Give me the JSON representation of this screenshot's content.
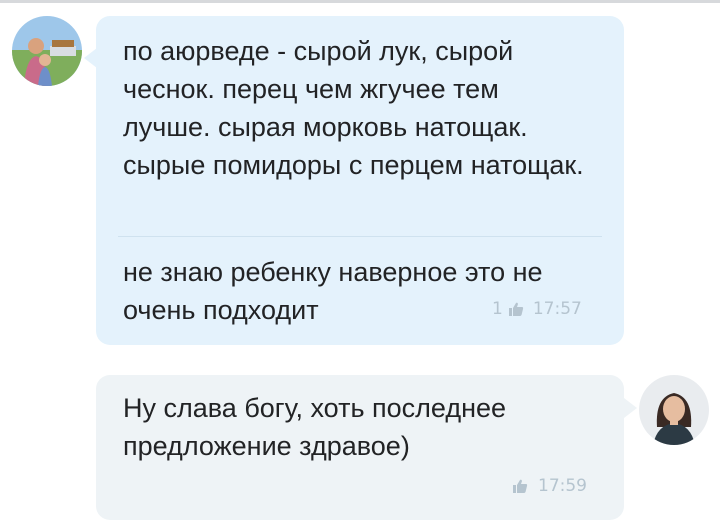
{
  "conversation": {
    "messages": [
      {
        "sender": "other",
        "avatar_icon": "user-avatar-icon",
        "parts": [
          {
            "text": "по аюрведе - сырой лук, сырой чеснок. перец чем жгучее тем лучше. сырая морковь натощак. сырые помидоры с перцем натощак."
          },
          {
            "text": "не знаю ребенку наверное это не очень подходит",
            "likes": "1",
            "time": "17:57"
          }
        ]
      },
      {
        "sender": "self",
        "avatar_icon": "user-avatar-icon",
        "parts": [
          {
            "text": "Ну слава богу, хоть последнее предложение здравое)",
            "time": "17:59"
          }
        ]
      }
    ]
  },
  "colors": {
    "incoming_bubble": "#e4f2fc",
    "outgoing_bubble": "#eef3f6",
    "text": "#222325",
    "meta": "#b5c4cf"
  }
}
